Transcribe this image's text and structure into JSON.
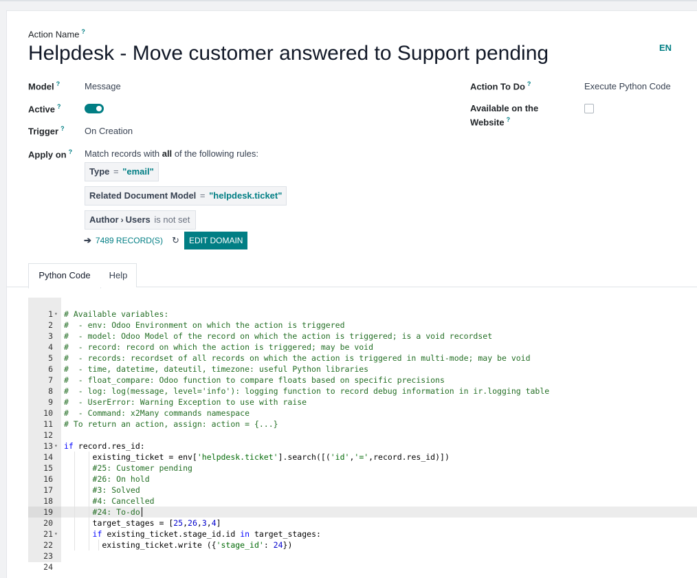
{
  "form": {
    "action_name_label": "Action Name",
    "help_mark": "?",
    "title": "Helpdesk - Move customer answered to Support pending",
    "lang_button": "EN",
    "model_label": "Model",
    "model_value": "Message",
    "active_label": "Active",
    "active_value": true,
    "trigger_label": "Trigger",
    "trigger_value": "On Creation",
    "apply_on_label": "Apply on",
    "apply_on_prefix": "Match records with",
    "apply_on_all": "all",
    "apply_on_suffix": "of the following rules:",
    "action_to_do_label": "Action To Do",
    "action_to_do_value": "Execute Python Code",
    "website_label_1": "Available on the",
    "website_label_2": "Website",
    "website_value": false
  },
  "domain_rules": [
    {
      "field": "Type",
      "operator": "=",
      "value": "\"email\""
    },
    {
      "field": "Related Document Model",
      "operator": "=",
      "value": "\"helpdesk.ticket\""
    },
    {
      "field_parent": "Author",
      "field": "Users",
      "operator": "is not set",
      "value": ""
    }
  ],
  "records": {
    "arrow": "➔",
    "count_label": "7489 RECORD(S)",
    "refresh_icon": "↻",
    "edit_domain_label": "EDIT DOMAIN"
  },
  "tabs": [
    {
      "label": "Python Code",
      "active": true
    },
    {
      "label": "Help",
      "active": false
    }
  ],
  "code_lines": [
    "# Available variables:",
    "#  - env: Odoo Environment on which the action is triggered",
    "#  - model: Odoo Model of the record on which the action is triggered; is a void recordset",
    "#  - record: record on which the action is triggered; may be void",
    "#  - records: recordset of all records on which the action is triggered in multi-mode; may be void",
    "#  - time, datetime, dateutil, timezone: useful Python libraries",
    "#  - float_compare: Odoo function to compare floats based on specific precisions",
    "#  - log: log(message, level='info'): logging function to record debug information in ir.logging table",
    "#  - UserError: Warning Exception to use with raise",
    "#  - Command: x2Many commands namespace",
    "# To return an action, assign: action = {...}",
    "",
    "if record.res_id:",
    "      existing_ticket = env['helpdesk.ticket'].search([('id','=',record.res_id)])",
    "      #25: Customer pending",
    "      #26: On hold",
    "      #3: Solved",
    "      #4: Cancelled",
    "      #24: To-do",
    "      target_stages = [25,26,3,4]",
    "      if existing_ticket.stage_id.id in target_stages:",
    "        existing_ticket.write ({'stage_id': 24})",
    "",
    ""
  ],
  "editor": {
    "active_line": 19,
    "fold_lines": [
      1,
      13,
      21
    ],
    "fold_icon": "▾"
  }
}
